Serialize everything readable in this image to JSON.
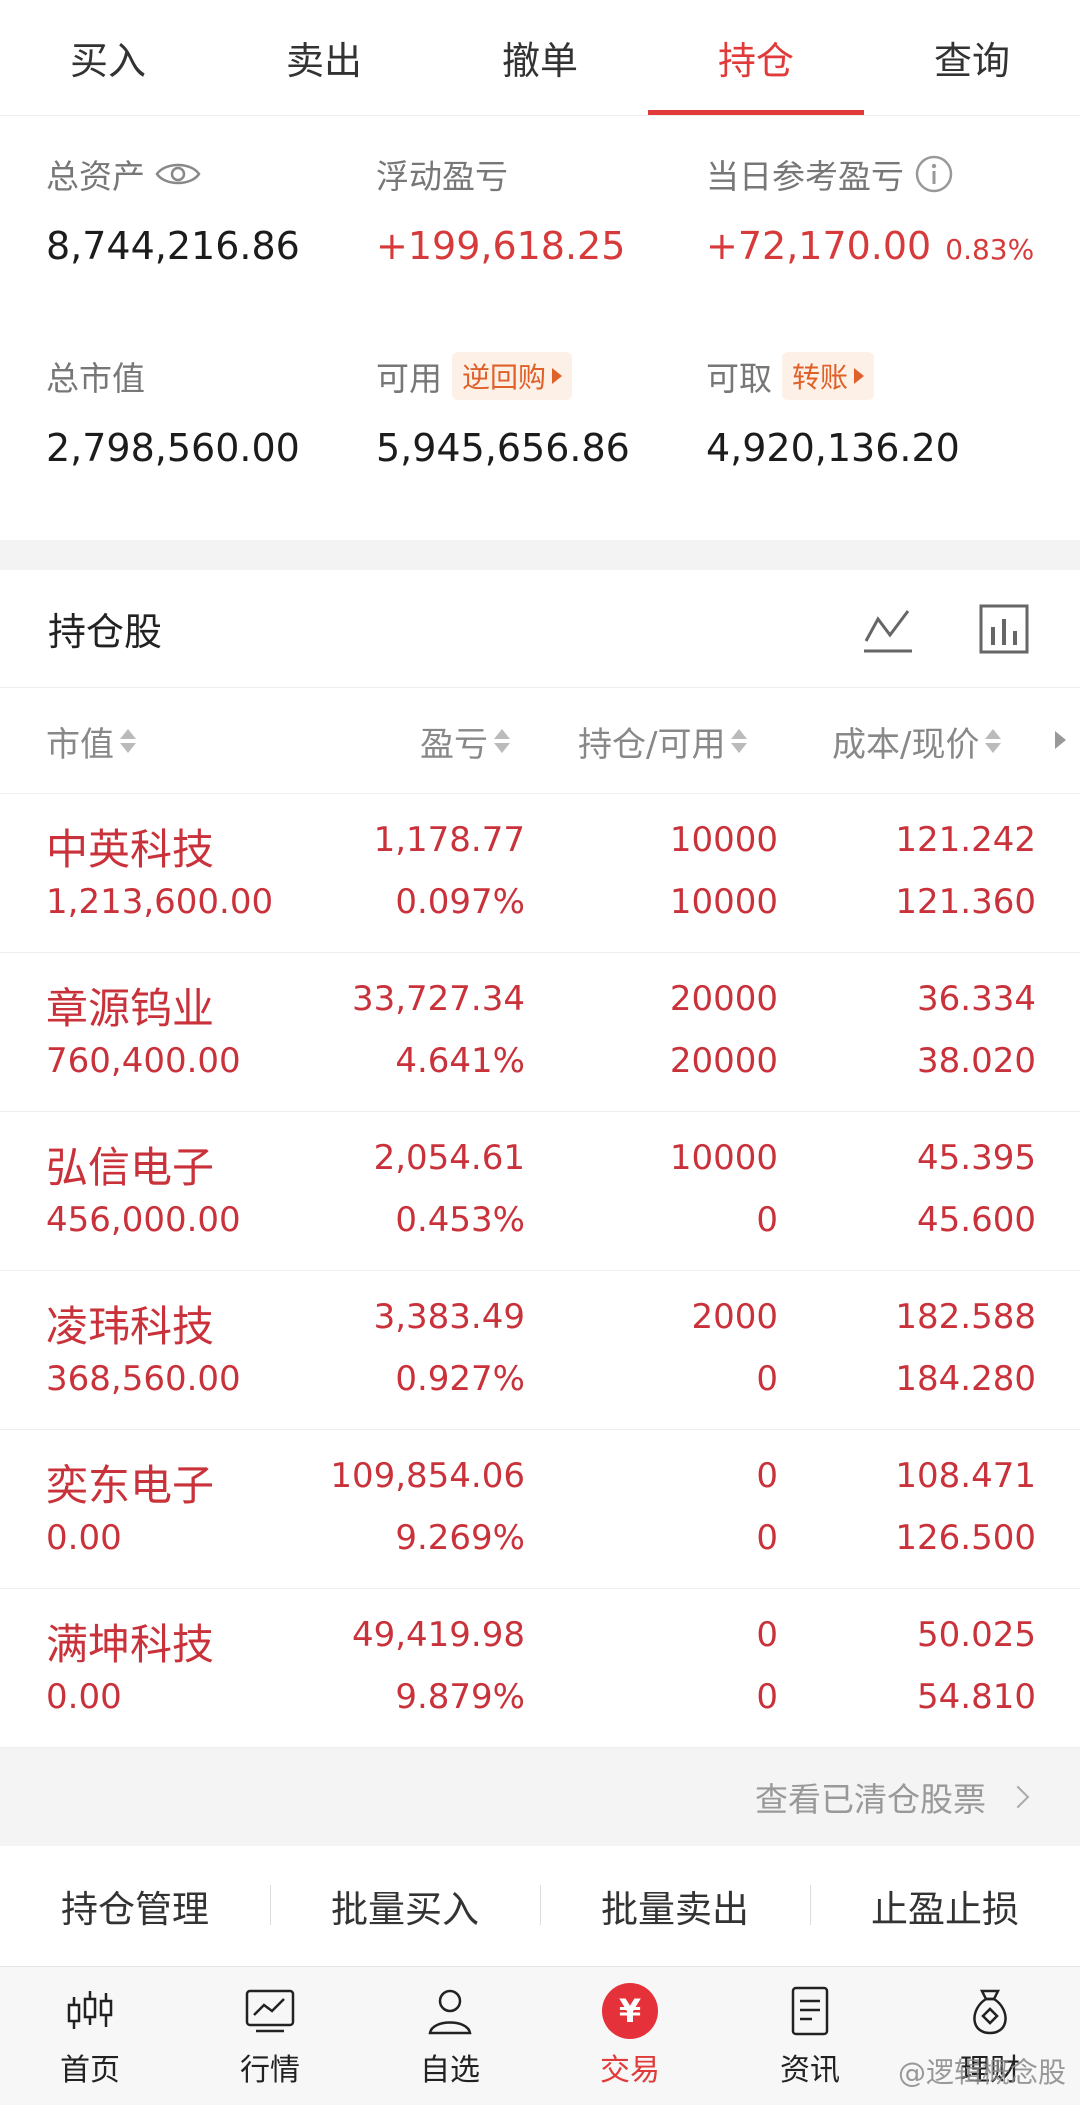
{
  "tabs": [
    {
      "label": "买入"
    },
    {
      "label": "卖出"
    },
    {
      "label": "撤单"
    },
    {
      "label": "持仓"
    },
    {
      "label": "查询"
    }
  ],
  "summary": {
    "total_assets_label": "总资产",
    "total_assets": "8,744,216.86",
    "floating_pl_label": "浮动盈亏",
    "floating_pl": "+199,618.25",
    "day_pl_label": "当日参考盈亏",
    "day_pl": "+72,170.00",
    "day_pl_pct": "0.83%",
    "market_value_label": "总市值",
    "market_value": "2,798,560.00",
    "available_label": "可用",
    "repo_tag": "逆回购",
    "available": "5,945,656.86",
    "withdrawable_label": "可取",
    "transfer_tag": "转账",
    "withdrawable": "4,920,136.20"
  },
  "holdings": {
    "title": "持仓股",
    "columns": [
      "市值",
      "盈亏",
      "持仓/可用",
      "成本/现价"
    ],
    "rows": [
      {
        "name": "中英科技",
        "mv": "1,213,600.00",
        "pl": "1,178.77",
        "plp": "0.097%",
        "q1": "10000",
        "q2": "10000",
        "p1": "121.242",
        "p2": "121.360"
      },
      {
        "name": "章源钨业",
        "mv": "760,400.00",
        "pl": "33,727.34",
        "plp": "4.641%",
        "q1": "20000",
        "q2": "20000",
        "p1": "36.334",
        "p2": "38.020"
      },
      {
        "name": "弘信电子",
        "mv": "456,000.00",
        "pl": "2,054.61",
        "plp": "0.453%",
        "q1": "10000",
        "q2": "0",
        "p1": "45.395",
        "p2": "45.600"
      },
      {
        "name": "凌玮科技",
        "mv": "368,560.00",
        "pl": "3,383.49",
        "plp": "0.927%",
        "q1": "2000",
        "q2": "0",
        "p1": "182.588",
        "p2": "184.280"
      },
      {
        "name": "奕东电子",
        "mv": "0.00",
        "pl": "109,854.06",
        "plp": "9.269%",
        "q1": "0",
        "q2": "0",
        "p1": "108.471",
        "p2": "126.500"
      },
      {
        "name": "满坤科技",
        "mv": "0.00",
        "pl": "49,419.98",
        "plp": "9.879%",
        "q1": "0",
        "q2": "0",
        "p1": "50.025",
        "p2": "54.810"
      }
    ]
  },
  "cleared_link": "查看已清仓股票",
  "actions": [
    "持仓管理",
    "批量买入",
    "批量卖出",
    "止盈止损"
  ],
  "bottom_nav": [
    {
      "label": "首页",
      "icon": "candlestick-icon"
    },
    {
      "label": "行情",
      "icon": "chart-icon"
    },
    {
      "label": "自选",
      "icon": "person-icon"
    },
    {
      "label": "交易",
      "icon": "yuan-icon"
    },
    {
      "label": "资讯",
      "icon": "document-icon"
    },
    {
      "label": "理财",
      "icon": "money-bag-icon"
    }
  ],
  "watermark": "@逻辑概念股",
  "colors": {
    "accent": "#e03a3a",
    "profit": "#c9323a"
  }
}
